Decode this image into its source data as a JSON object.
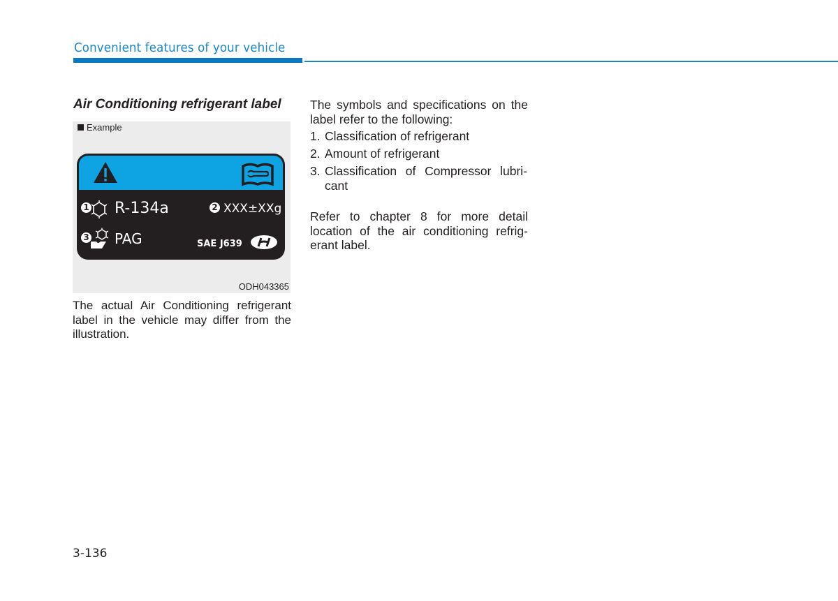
{
  "header": {
    "section_title": "Convenient features of your vehicle"
  },
  "article": {
    "title": "Air Conditioning refrigerant label",
    "figure": {
      "caption": "Example",
      "code": "ODH043365",
      "label": {
        "refrigerant": "R-134a",
        "amount": "XXX±XXg",
        "lubricant": "PAG",
        "standard": "SAE J639",
        "markers": [
          "1",
          "2",
          "3"
        ],
        "colors": {
          "top_band": "#0ea3e3",
          "body": "#231f20"
        }
      }
    },
    "note": "The actual Air Conditioning refrigerant label in the vehicle may differ from the illustration."
  },
  "right_column": {
    "intro": "The symbols and specifications on the label refer to the following:",
    "items": [
      {
        "num": "1.",
        "text": "Classification of refrigerant"
      },
      {
        "num": "2.",
        "text": "Amount of refrigerant"
      },
      {
        "num": "3.",
        "text": "Classification of Compressor lubri-cant"
      }
    ],
    "outro": "Refer to chapter 8 for more detail location of the air conditioning refrig-erant label."
  },
  "footer": {
    "page_number": "3-136"
  },
  "colors": {
    "accent": "#1a86c8"
  }
}
